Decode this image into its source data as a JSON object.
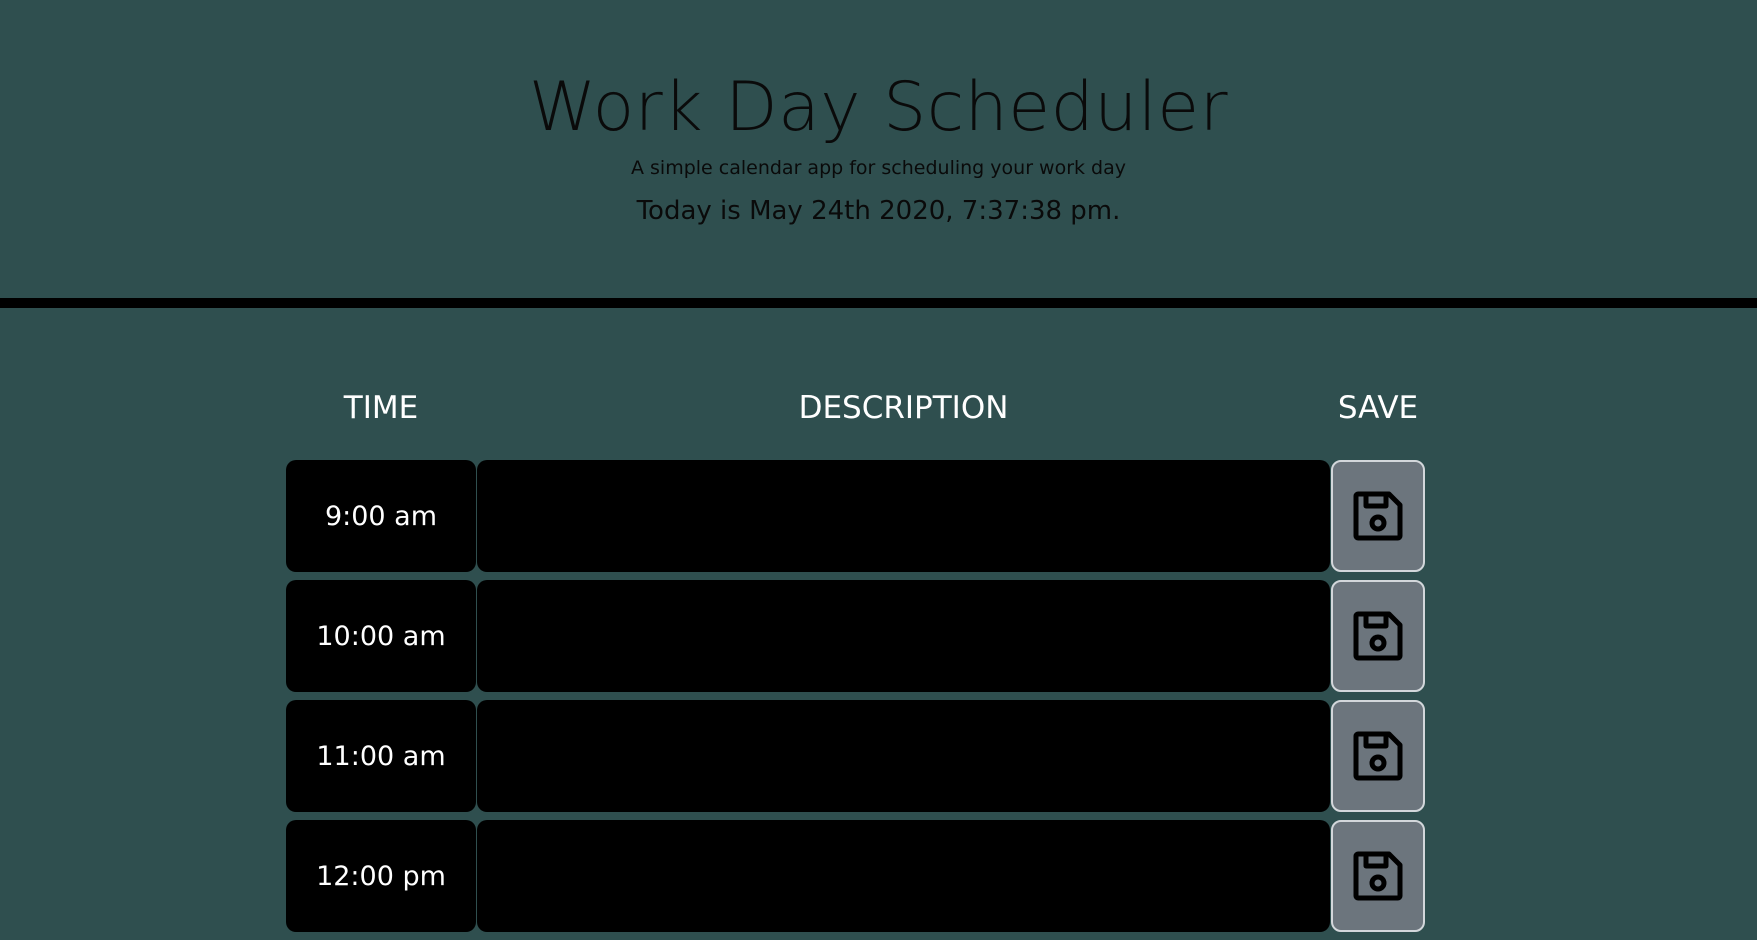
{
  "header": {
    "title": "Work Day Scheduler",
    "lead": "A simple calendar app for scheduling your work day",
    "today": "Today is May 24th 2020, 7:37:38 pm."
  },
  "columns": {
    "time": "TIME",
    "description": "DESCRIPTION",
    "save": "SAVE"
  },
  "rows": [
    {
      "time": "9:00 am",
      "description": "",
      "save_icon": "floppy-disk-icon"
    },
    {
      "time": "10:00 am",
      "description": "",
      "save_icon": "floppy-disk-icon"
    },
    {
      "time": "11:00 am",
      "description": "",
      "save_icon": "floppy-disk-icon"
    },
    {
      "time": "12:00 pm",
      "description": "",
      "save_icon": "floppy-disk-icon"
    }
  ],
  "colors": {
    "background": "#2f4f4f",
    "row_background": "#000000",
    "save_button": "#6c757d"
  }
}
